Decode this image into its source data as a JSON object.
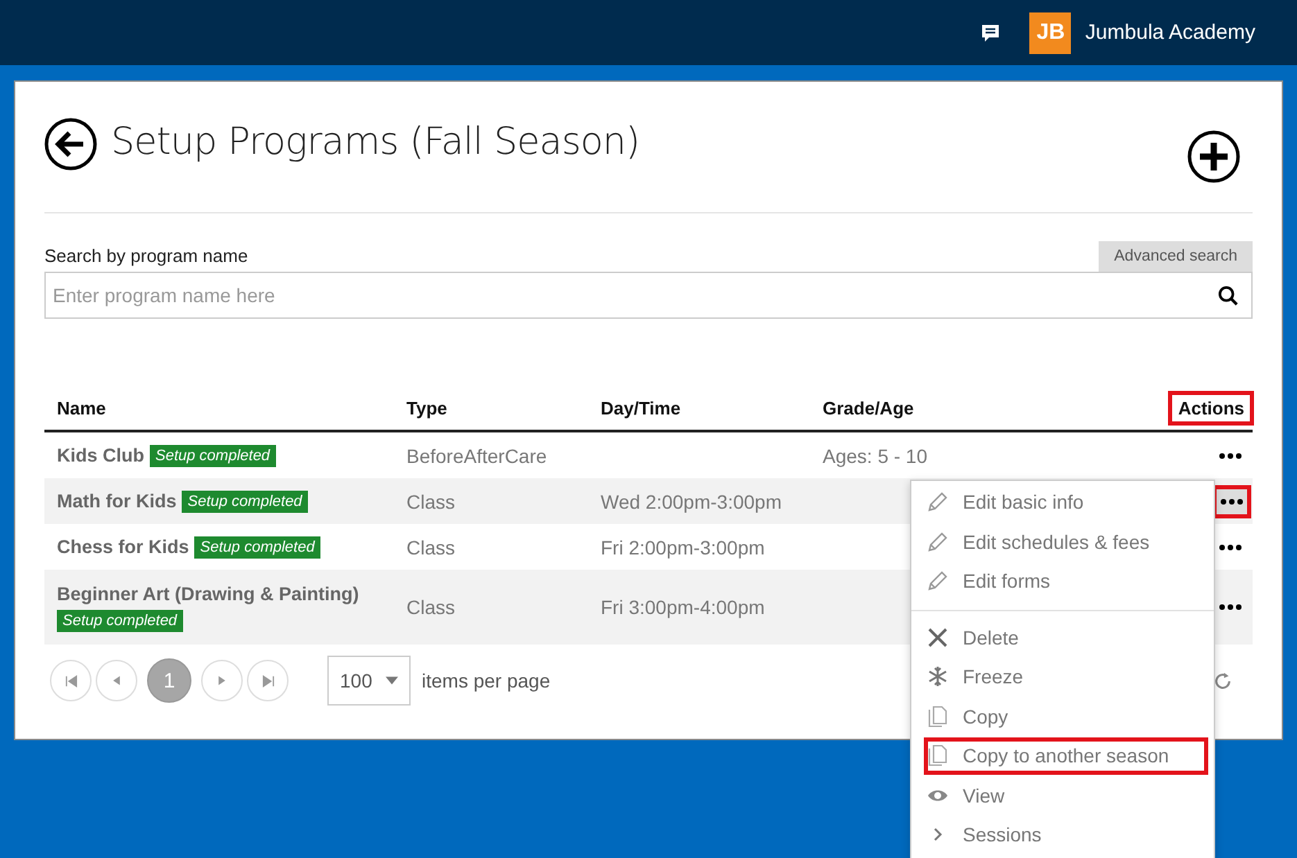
{
  "top_bar": {
    "org_name": "Jumbula Academy",
    "logo_text": "JB"
  },
  "page": {
    "title": "Setup Programs (Fall Season)"
  },
  "search": {
    "label": "Search by program name",
    "placeholder": "Enter program name here",
    "advanced_button": "Advanced search"
  },
  "table": {
    "columns": [
      {
        "label": "Name",
        "highlighted": false
      },
      {
        "label": "Type",
        "highlighted": false
      },
      {
        "label": "Day/Time",
        "highlighted": false
      },
      {
        "label": "Grade/Age",
        "highlighted": false
      },
      {
        "label": "Actions",
        "highlighted": true
      }
    ],
    "rows": [
      {
        "name": "Kids Club",
        "badge": "Setup completed",
        "type": "BeforeAfterCare",
        "day_time": "",
        "grade_age": "Ages: 5 - 10",
        "menu_open": false
      },
      {
        "name": "Math for Kids",
        "badge": "Setup completed",
        "type": "Class",
        "day_time": "Wed 2:00pm-3:00pm",
        "grade_age": "",
        "menu_open": true
      },
      {
        "name": "Chess for Kids",
        "badge": "Setup completed",
        "type": "Class",
        "day_time": "Fri 2:00pm-3:00pm",
        "grade_age": "",
        "menu_open": false
      },
      {
        "name": "Beginner Art (Drawing & Painting)",
        "badge": "Setup completed",
        "type": "Class",
        "day_time": "Fri 3:00pm-4:00pm",
        "grade_age": "",
        "menu_open": false
      }
    ]
  },
  "pagination": {
    "pages": [
      {
        "label": "1",
        "selected": true
      }
    ],
    "page_size": "100",
    "page_size_label": "items per page"
  },
  "action_menu": {
    "groups": [
      [
        {
          "label": "Edit basic info",
          "kind": "edit",
          "highlighted": false
        },
        {
          "label": "Edit schedules & fees",
          "kind": "edit",
          "highlighted": false
        },
        {
          "label": "Edit forms",
          "kind": "edit",
          "highlighted": false
        }
      ],
      [
        {
          "label": "Delete",
          "kind": "delete",
          "highlighted": false
        },
        {
          "label": "Freeze",
          "kind": "freeze",
          "highlighted": false
        },
        {
          "label": "Copy",
          "kind": "copy",
          "highlighted": false
        },
        {
          "label": "Copy to another season",
          "kind": "copy",
          "highlighted": true
        },
        {
          "label": "View",
          "kind": "view",
          "highlighted": false
        },
        {
          "label": "Sessions",
          "kind": "submenu",
          "highlighted": false
        }
      ]
    ]
  }
}
